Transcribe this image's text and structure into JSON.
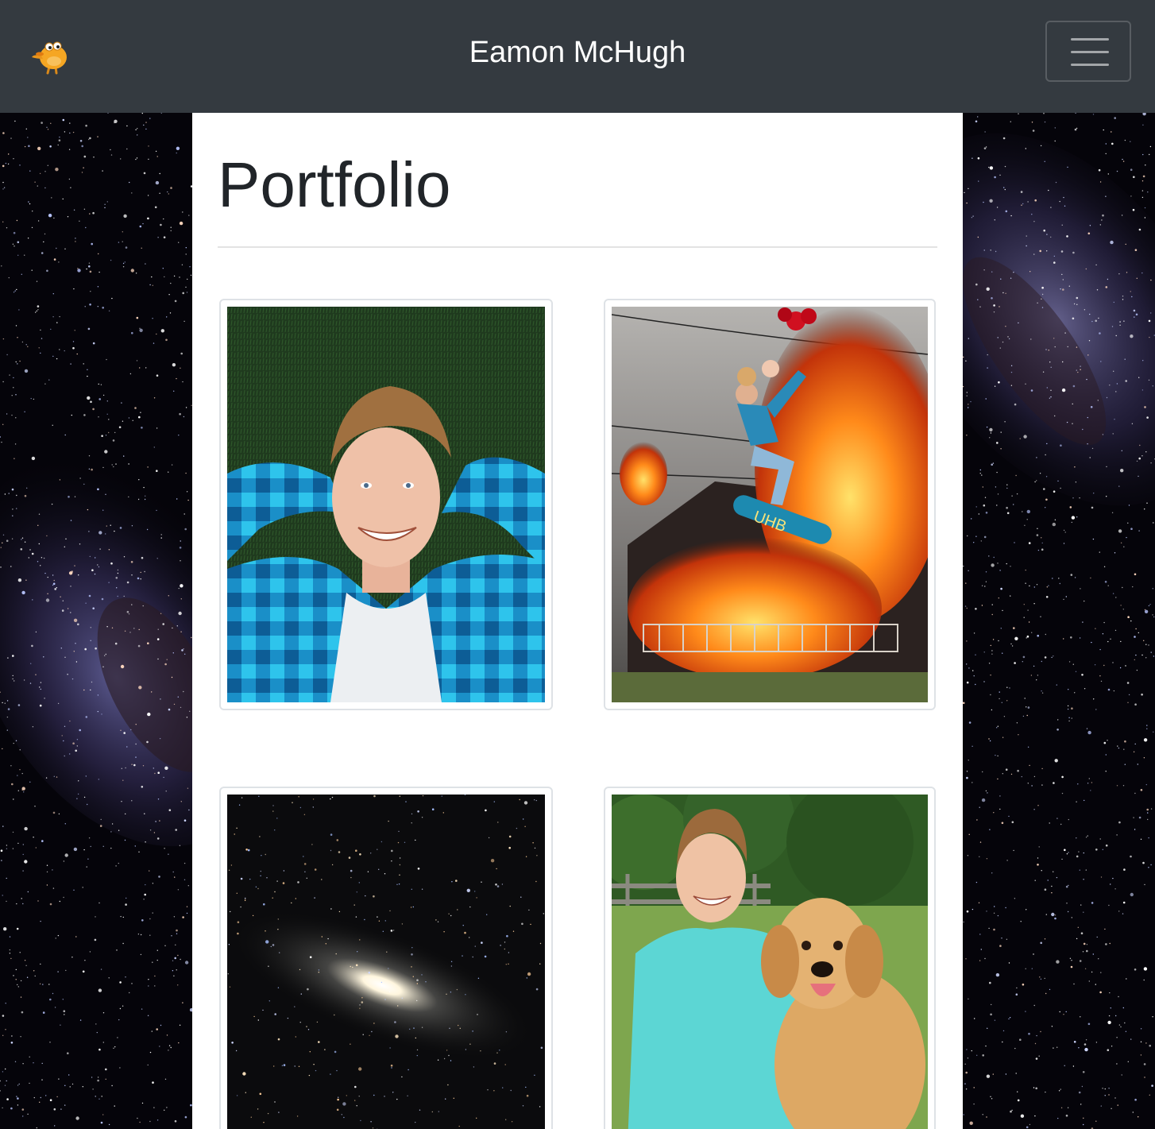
{
  "navbar": {
    "brand_logo_icon": "cartoon-duck-icon",
    "title": "Eamon McHugh",
    "menu_toggle_icon": "hamburger-menu-icon"
  },
  "page": {
    "heading": "Portfolio"
  },
  "portfolio": {
    "items": [
      {
        "image": "portrait-on-grass-photo"
      },
      {
        "image": "skateboard-over-burning-house-photo"
      },
      {
        "image": "galaxy-night-sky-photo"
      },
      {
        "image": "portrait-with-golden-retriever-photo"
      }
    ]
  },
  "colors": {
    "navbar_bg": "#343a40",
    "navbar_text": "#ffffff",
    "heading_text": "#212529",
    "content_bg": "#ffffff",
    "background": "#000000"
  }
}
